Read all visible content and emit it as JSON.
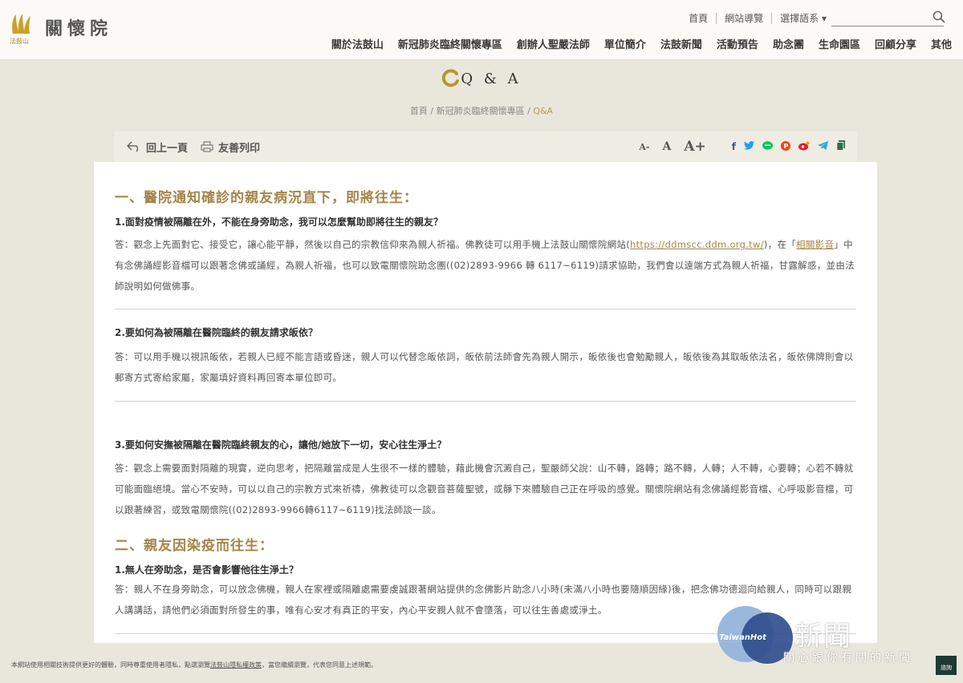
{
  "header": {
    "logo_text": "關懷院",
    "logo_sub": "法鼓山",
    "top_links": [
      "首頁",
      "網站導覽",
      "選擇語系"
    ],
    "nav": [
      "關於法鼓山",
      "新冠肺炎臨終關懷專區",
      "創辦人聖嚴法師",
      "單位簡介",
      "法鼓新聞",
      "活動預告",
      "助念團",
      "生命園區",
      "回顧分享",
      "其他"
    ]
  },
  "page": {
    "title": "Q & A",
    "breadcrumb": [
      "首頁",
      "新冠肺炎臨終關懷專區",
      "Q&A"
    ]
  },
  "toolbar": {
    "back": "回上一頁",
    "print": "友善列印",
    "font_small": "A-",
    "font_mid": "A",
    "font_large": "A+",
    "share_colors": [
      "#3b5998",
      "#1da1f2",
      "#06c755",
      "#e60023",
      "#e6162d",
      "#2ca5e0",
      "#2b6e4f"
    ],
    "share_icons": [
      "facebook-icon",
      "twitter-icon",
      "line-icon",
      "plurk-icon",
      "weibo-icon",
      "telegram-icon",
      "copy-icon"
    ]
  },
  "content": {
    "sec1_title": "一、醫院通知確診的親友病況直下，即將往生：",
    "q1": "1.面對疫情被隔離在外，不能在身旁助念，我可以怎麼幫助即將往生的親友？",
    "a1_p1": "答：觀念上先面對它、接受它，讓心能平靜，然後以自己的宗教信仰來為親人祈福。佛教徒可以用手機上法鼓山關懷院網站(",
    "a1_link1": "https://ddmscc.ddm.org.tw/",
    "a1_p2": ")，在「",
    "a1_link2": "相關影音",
    "a1_p3": "」中有念佛誦經影音檔可以跟著念佛或誦經，為親人祈福，也可以致電關懷院助念團((02)2893-9966 轉 6117~6119)請求協助，我們會以遠端方式為親人祈福，甘露解惑，並由法師說明如何做佛事。",
    "q2": "2.要如何為被隔離在醫院臨終的親友請求皈依？",
    "a2": "答：可以用手機以視訊皈依，若親人已經不能言語或昏迷，親人可以代替念皈依詞，皈依前法師會先為親人開示，皈依後也會勉勵親人，皈依後為其取皈依法名，皈依佛牌則會以郵寄方式寄給家屬，家屬填好資料再回寄本單位即可。",
    "q3": "3.要如何安撫被隔離在醫院臨終親友的心，讓他/她放下一切，安心往生淨土？",
    "a3": "答：觀念上需要面對隔離的現實，逆向思考，把隔離當成是人生很不一樣的體驗，藉此機會沉澱自己，聖嚴師父說：山不轉，路轉；路不轉，人轉；人不轉，心要轉；心若不轉就可能面臨絕境。當心不安時，可以以自己的宗教方式來祈禱，佛教徒可以念觀音菩薩聖號，或靜下來體驗自己正在呼吸的感覺。關懷院網站有念佛誦經影音檔、心呼吸影音檔，可以跟著練習，或致電關懷院((02)2893-9966轉6117~6119)找法師談一談。",
    "sec2_title": "二、親友因染疫而往生：",
    "q4": "1.無人在旁助念，是否會影響他往生淨土？",
    "a4": "答：親人不在身旁助念，可以放念佛機，親人在家裡或隔離處需要虔誠跟著網站提供的念佛影片助念八小時(未滿八小時也要隨順因緣)後，把念佛功德迴向給親人，同時可以跟親人講講話，請他們必須面對所發生的事，唯有心安才有真正的平安，內心平安親人就不會墮落，可以往生善處或淨土。"
  },
  "footer": {
    "text1": "本網站使用相關技術提供更好的體驗，同時尊重使用者隱私，點選瀏覽",
    "link": "法鼓山隱私權政策",
    "text2": "，當您繼續瀏覽，代表您同意上述規範。",
    "chat": "諮詢"
  },
  "watermark": {
    "brand": "TaiwanHot",
    "big": "新聞",
    "small": "關心跟你有關的新聞"
  }
}
